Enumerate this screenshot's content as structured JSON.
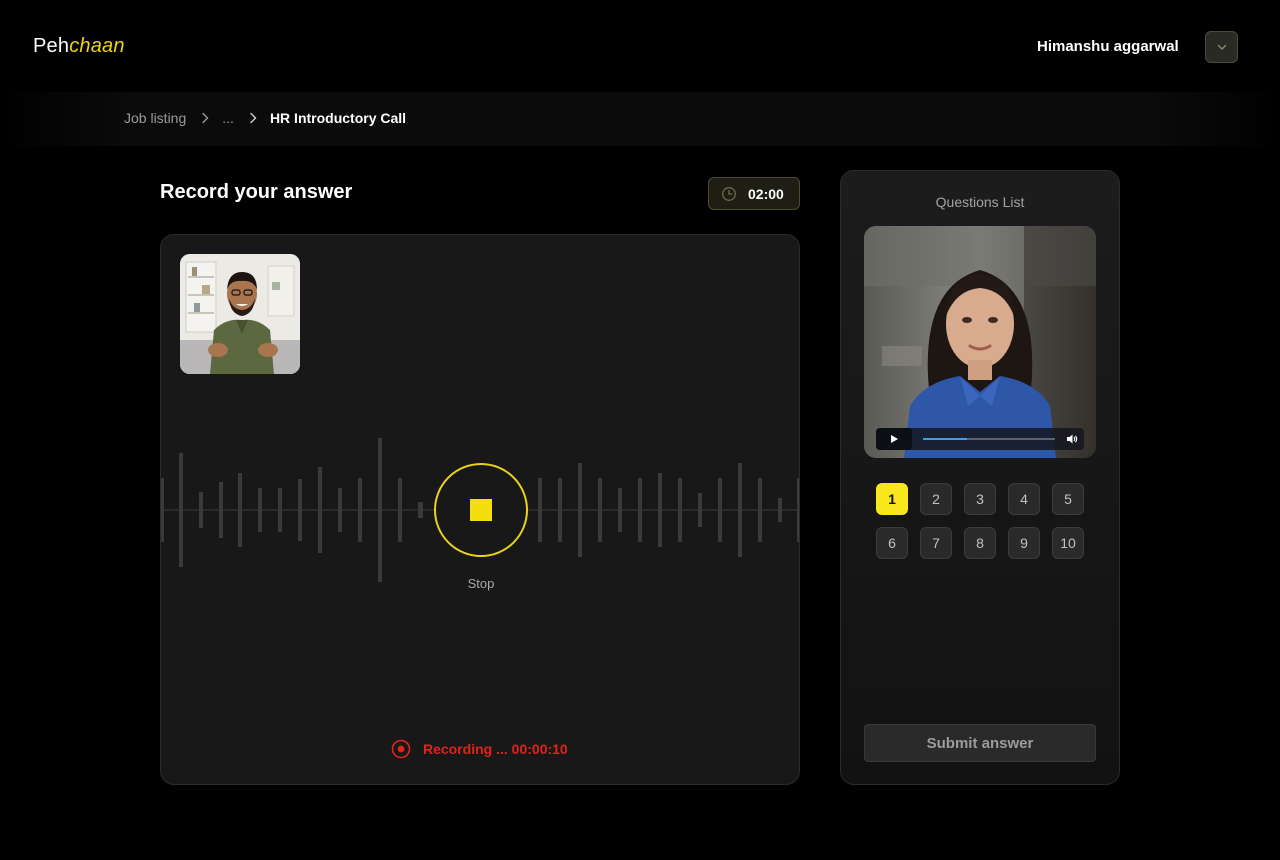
{
  "brand": {
    "name_part1": "Peh",
    "name_part2": "chaan",
    "accent": "#f0d21c"
  },
  "user": {
    "name": "Himanshu aggarwal",
    "menu_icon": "chevron-down-icon"
  },
  "breadcrumb": {
    "items": [
      "Job listing",
      "...",
      "HR Introductory Call"
    ]
  },
  "recorder": {
    "title": "Record your answer",
    "timer": "02:00",
    "stop_label": "Stop",
    "status": "Recording ... 00:00:10",
    "status_color": "#e0231b"
  },
  "questions": {
    "title": "Questions List",
    "video_progress": 0.33,
    "numbers": [
      "1",
      "2",
      "3",
      "4",
      "5",
      "6",
      "7",
      "8",
      "9",
      "10"
    ],
    "active": "1",
    "submit_label": "Submit answer"
  }
}
